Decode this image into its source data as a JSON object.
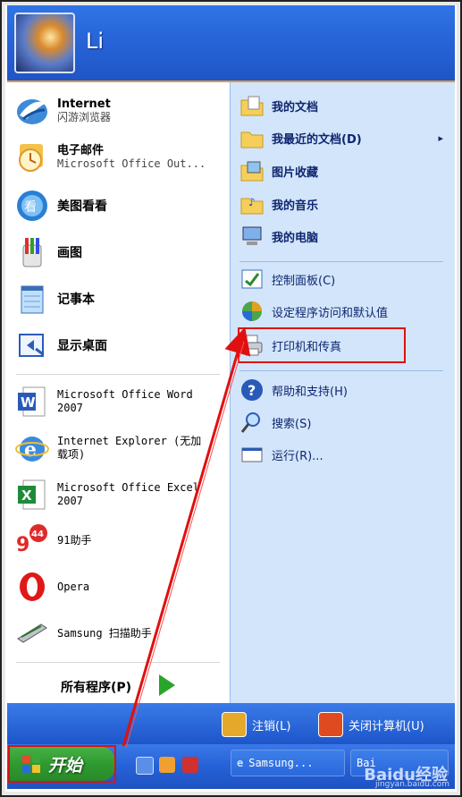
{
  "user": {
    "name": "Li"
  },
  "left_pinned": [
    {
      "title": "Internet",
      "subtitle": "闪游浏览器",
      "icon": "browser-bird-icon"
    },
    {
      "title": "电子邮件",
      "subtitle": "Microsoft Office Out...",
      "icon": "outlook-icon"
    }
  ],
  "left_recent": [
    {
      "label": "美图看看",
      "icon": "meitu-viewer-icon"
    },
    {
      "label": "画图",
      "icon": "paint-icon"
    },
    {
      "label": "记事本",
      "icon": "notepad-icon"
    },
    {
      "label": "显示桌面",
      "icon": "show-desktop-icon"
    }
  ],
  "left_programs": [
    {
      "line1": "Microsoft Office Word",
      "line2": "2007",
      "icon": "word-icon"
    },
    {
      "line1": "Internet Explorer (无加",
      "line2": "载项)",
      "icon": "ie-icon"
    },
    {
      "line1": "Microsoft Office Excel",
      "line2": "2007",
      "icon": "excel-icon"
    },
    {
      "line1": "91助手",
      "line2": "",
      "icon": "assistant-91-icon"
    },
    {
      "line1": "Opera",
      "line2": "",
      "icon": "opera-icon"
    },
    {
      "line1": "Samsung 扫描助手",
      "line2": "",
      "icon": "scanner-icon"
    }
  ],
  "all_programs": "所有程序(P)",
  "badge_91": "44",
  "right_top": [
    {
      "label": "我的文档",
      "icon": "my-documents-icon"
    },
    {
      "label": "我最近的文档(D)",
      "icon": "recent-documents-icon",
      "submenu": "▸"
    },
    {
      "label": "图片收藏",
      "icon": "my-pictures-icon"
    },
    {
      "label": "我的音乐",
      "icon": "my-music-icon"
    },
    {
      "label": "我的电脑",
      "icon": "my-computer-icon"
    }
  ],
  "right_mid": [
    {
      "label": "控制面板(C)",
      "icon": "control-panel-icon"
    },
    {
      "label": "设定程序访问和默认值",
      "icon": "program-defaults-icon"
    },
    {
      "label": "打印机和传真",
      "icon": "printer-fax-icon"
    }
  ],
  "right_bottom": [
    {
      "label": "帮助和支持(H)",
      "icon": "help-icon"
    },
    {
      "label": "搜索(S)",
      "icon": "search-icon"
    },
    {
      "label": "运行(R)...",
      "icon": "run-icon"
    }
  ],
  "footer": {
    "logoff": "注销(L)",
    "shutdown": "关闭计算机(U)"
  },
  "taskbar": {
    "start_label": "开始",
    "task1": "Samsung...",
    "task2": "Bai"
  },
  "watermark": {
    "line1": "Baidu经验",
    "line2": "jingyan.baidu.com"
  },
  "colors": {
    "header_blue": "#2866d9",
    "right_pane": "#d3e5fa",
    "start_green": "#2f9a2f",
    "highlight_red": "#e01010"
  }
}
